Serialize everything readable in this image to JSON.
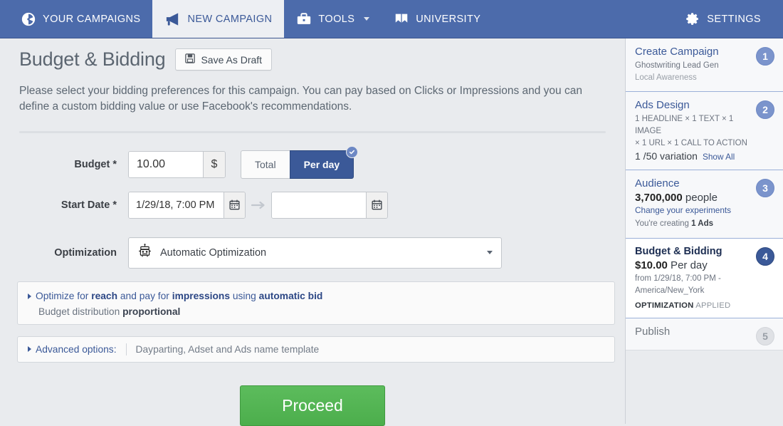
{
  "nav": {
    "items": [
      {
        "label": "YOUR CAMPAIGNS",
        "icon": "dashboard-icon",
        "active": false
      },
      {
        "label": "NEW CAMPAIGN",
        "icon": "megaphone-icon",
        "active": true
      },
      {
        "label": "TOOLS",
        "icon": "briefcase-icon",
        "active": false,
        "caret": true
      },
      {
        "label": "UNIVERSITY",
        "icon": "book-icon",
        "active": false
      }
    ],
    "settings_label": "SETTINGS",
    "settings_icon": "gear-icon",
    "bar_color": "#4c6bab",
    "active_tab_color": "#3b5998"
  },
  "header": {
    "title": "Budget & Bidding",
    "save_draft_label": "Save As Draft",
    "save_draft_icon": "floppy-disk-icon"
  },
  "intro": {
    "text": "Please select your bidding preferences for this campaign. You can pay based on Clicks or Impressions and you can define a custom bidding value or use Facebook's recommendations."
  },
  "form": {
    "budget": {
      "label": "Budget *",
      "value": "10.00",
      "placeholder": "",
      "currency_suffix": "$",
      "toggle": {
        "options": [
          "Total",
          "Per day"
        ],
        "selected": "Per day",
        "check_icon": "checkmark-icon"
      }
    },
    "start_date": {
      "label": "Start Date *",
      "value": "1/29/18, 7:00 PM",
      "placeholder": "",
      "end_value": "",
      "end_placeholder": "",
      "calendar_icon": "calendar-icon",
      "arrow_icon": "arrow-right-icon"
    },
    "optimization": {
      "label": "Optimization",
      "selected": "Automatic Optimization",
      "icon": "robot-icon",
      "caret_icon": "chevron-down-icon"
    }
  },
  "optimize_panel": {
    "prefix": "Optimize for ",
    "bold1": "reach",
    "mid1": " and pay for ",
    "bold2": "impressions",
    "mid2": " using ",
    "bold3": "automatic bid",
    "line2_prefix": "Budget distribution ",
    "line2_bold": "proportional",
    "expand_icon": "triangle-right-icon"
  },
  "advanced_panel": {
    "label": "Advanced options:",
    "text": "Dayparting, Adset and Ads name template",
    "expand_icon": "triangle-right-icon"
  },
  "proceed": {
    "label": "Proceed",
    "color": "#4cae4c"
  },
  "steps": [
    {
      "number": "1",
      "title": "Create Campaign",
      "sub1": "Ghostwriting Lead Gen",
      "sub2": "Local Awareness",
      "state": "done"
    },
    {
      "number": "2",
      "title": "Ads Design",
      "sub1": "1 HEADLINE × 1 TEXT × 1 IMAGE",
      "sub2": "× 1 URL × 1 CALL TO ACTION",
      "variation": "1 /50 variation",
      "link": "Show All",
      "state": "done"
    },
    {
      "number": "3",
      "title": "Audience",
      "people_count": "3,700,000",
      "people_label": " people",
      "link": "Change your experiments",
      "creating_prefix": "You're creating ",
      "creating_count": "1 Ads",
      "state": "done"
    },
    {
      "number": "4",
      "title": "Budget & Bidding",
      "amount": "$10.00",
      "amount_suffix": " Per day",
      "from_line1": "from 1/29/18, 7:00 PM -",
      "from_line2": "America/New_York",
      "caps_bold": "OPTIMIZATION",
      "caps_rest": " APPLIED",
      "state": "active"
    },
    {
      "number": "5",
      "title": "Publish",
      "state": "pending"
    }
  ]
}
